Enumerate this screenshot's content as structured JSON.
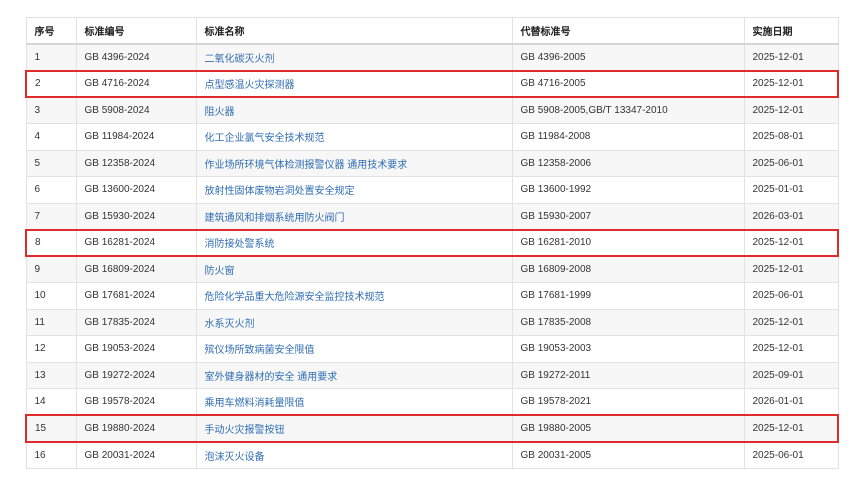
{
  "columns": {
    "seq": "序号",
    "code": "标准编号",
    "name": "标准名称",
    "replaced": "代替标准号",
    "date": "实施日期"
  },
  "highlight_color": "#e02b2b",
  "link_color": "#2f6db3",
  "rows": [
    {
      "seq": "1",
      "code": "GB 4396-2024",
      "name": "二氧化碳灭火剂",
      "replaced": "GB 4396-2005",
      "date": "2025-12-01",
      "highlight": false
    },
    {
      "seq": "2",
      "code": "GB 4716-2024",
      "name": "点型感温火灾探测器",
      "replaced": "GB 4716-2005",
      "date": "2025-12-01",
      "highlight": true
    },
    {
      "seq": "3",
      "code": "GB 5908-2024",
      "name": "阻火器",
      "replaced": "GB 5908-2005,GB/T 13347-2010",
      "date": "2025-12-01",
      "highlight": false
    },
    {
      "seq": "4",
      "code": "GB 11984-2024",
      "name": "化工企业氯气安全技术规范",
      "replaced": "GB 11984-2008",
      "date": "2025-08-01",
      "highlight": false
    },
    {
      "seq": "5",
      "code": "GB 12358-2024",
      "name": "作业场所环境气体检测报警仪器 通用技术要求",
      "replaced": "GB 12358-2006",
      "date": "2025-06-01",
      "highlight": false
    },
    {
      "seq": "6",
      "code": "GB 13600-2024",
      "name": "放射性固体废物岩洞处置安全规定",
      "replaced": "GB 13600-1992",
      "date": "2025-01-01",
      "highlight": false
    },
    {
      "seq": "7",
      "code": "GB 15930-2024",
      "name": "建筑通风和排烟系统用防火阀门",
      "replaced": "GB 15930-2007",
      "date": "2026-03-01",
      "highlight": false
    },
    {
      "seq": "8",
      "code": "GB 16281-2024",
      "name": "消防接处警系统",
      "replaced": "GB 16281-2010",
      "date": "2025-12-01",
      "highlight": true
    },
    {
      "seq": "9",
      "code": "GB 16809-2024",
      "name": "防火窗",
      "replaced": "GB 16809-2008",
      "date": "2025-12-01",
      "highlight": false
    },
    {
      "seq": "10",
      "code": "GB 17681-2024",
      "name": "危险化学品重大危险源安全监控技术规范",
      "replaced": "GB 17681-1999",
      "date": "2025-06-01",
      "highlight": false
    },
    {
      "seq": "11",
      "code": "GB 17835-2024",
      "name": "水系灭火剂",
      "replaced": "GB 17835-2008",
      "date": "2025-12-01",
      "highlight": false
    },
    {
      "seq": "12",
      "code": "GB 19053-2024",
      "name": "殡仪场所致病菌安全限值",
      "replaced": "GB 19053-2003",
      "date": "2025-12-01",
      "highlight": false
    },
    {
      "seq": "13",
      "code": "GB 19272-2024",
      "name": "室外健身器材的安全 通用要求",
      "replaced": "GB 19272-2011",
      "date": "2025-09-01",
      "highlight": false
    },
    {
      "seq": "14",
      "code": "GB 19578-2024",
      "name": "乘用车燃料消耗量限值",
      "replaced": "GB 19578-2021",
      "date": "2026-01-01",
      "highlight": false
    },
    {
      "seq": "15",
      "code": "GB 19880-2024",
      "name": "手动火灾报警按钮",
      "replaced": "GB 19880-2005",
      "date": "2025-12-01",
      "highlight": true
    },
    {
      "seq": "16",
      "code": "GB 20031-2024",
      "name": "泡沫灭火设备",
      "replaced": "GB 20031-2005",
      "date": "2025-06-01",
      "highlight": false
    }
  ]
}
